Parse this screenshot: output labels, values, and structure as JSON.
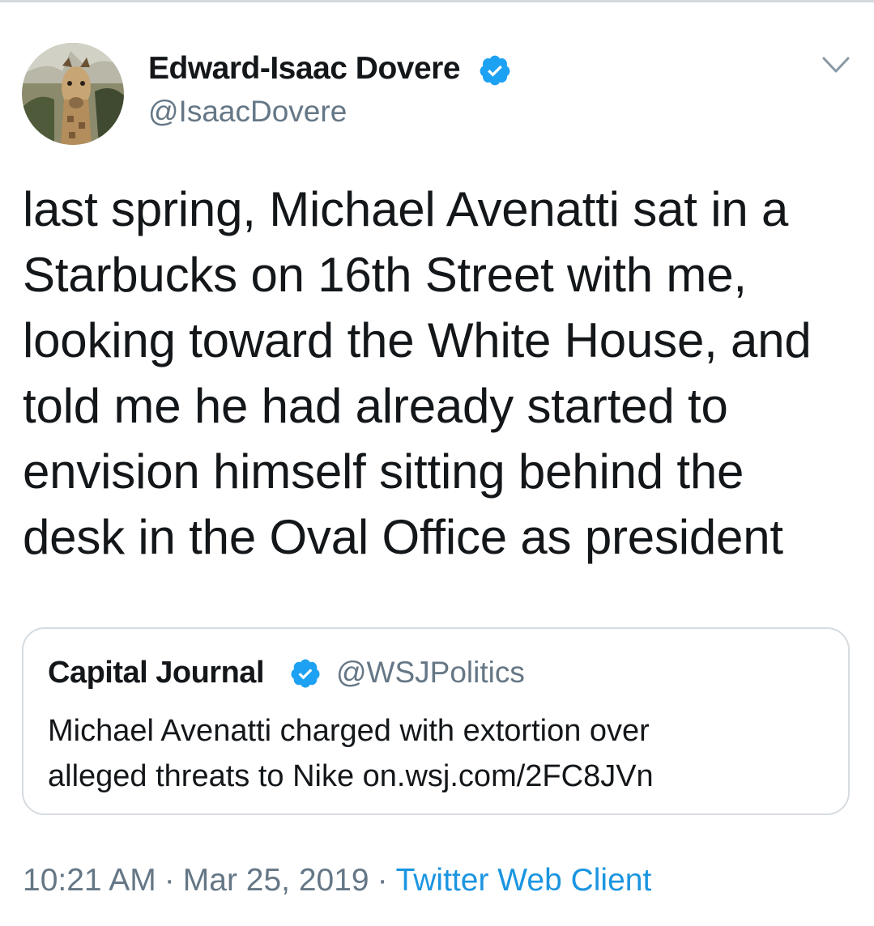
{
  "author": {
    "display_name": "Edward-Isaac Dovere",
    "handle": "@IsaacDovere",
    "verified": true,
    "avatar_icon": "giraffe-avatar"
  },
  "tweet": {
    "lines": [
      "last spring, Michael Avenatti sat in a",
      "Starbucks on 16th Street with me,",
      "looking toward the White House, and",
      "told me he had already started to",
      "envision himself sitting behind the",
      "desk in the Oval Office as president"
    ]
  },
  "quoted_tweet": {
    "display_name": "Capital Journal",
    "handle": "@WSJPolitics",
    "verified": true,
    "lines": [
      "Michael Avenatti charged with extortion over",
      "alleged threats to Nike on.wsj.com/2FC8JVn"
    ]
  },
  "meta": {
    "time": "10:21 AM",
    "separator": "·",
    "date": "Mar 25, 2019",
    "client": "Twitter Web Client"
  },
  "colors": {
    "verified_blue": "#1da1f2",
    "secondary_text": "#657786",
    "link_blue": "#1b95e0",
    "border": "#d6dbe0"
  }
}
